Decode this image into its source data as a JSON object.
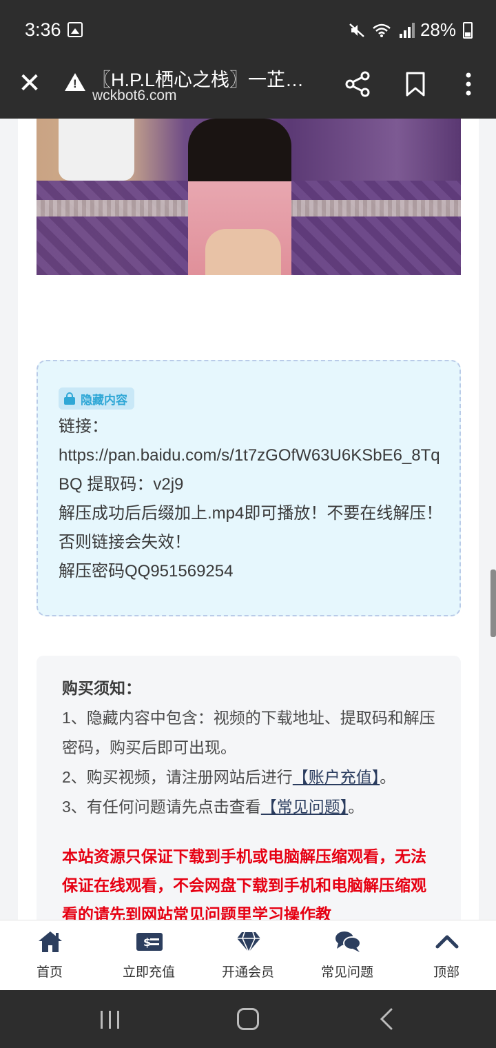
{
  "status_bar": {
    "time": "3:36",
    "battery": "28%"
  },
  "browser": {
    "title": "〖H.P.L栖心之栈〗一芷…",
    "url": "wckbot6.com"
  },
  "hidden_content": {
    "badge": "隐藏内容",
    "lines": [
      "链接：",
      "https://pan.baidu.com/s/1t7zGOfW63U6KSbE6_8TqBQ 提取码：v2j9",
      "解压成功后后缀加上.mp4即可播放！不要在线解压！否则链接会失效！",
      "解压密码QQ951569254"
    ]
  },
  "notice": {
    "heading": "购买须知：",
    "item1": "1、隐藏内容中包含：视频的下载地址、提取码和解压密码，购买后即可出现。",
    "item2_prefix": "2、购买视频，请注册网站后进行",
    "item2_link": "【账户充值】",
    "item2_suffix": "。",
    "item3_prefix": "3、有任何问题请先点击查看",
    "item3_link": "【常见问题】",
    "item3_suffix": "。",
    "warning": "本站资源只保证下载到手机或电脑解压缩观看，无法保证在线观看，不会网盘下载到手机和电脑解压缩观看的请先到网站常见问题里学习操作教"
  },
  "bottom_nav": {
    "items": [
      {
        "label": "首页",
        "icon": "home-icon"
      },
      {
        "label": "立即充值",
        "icon": "money-icon"
      },
      {
        "label": "开通会员",
        "icon": "diamond-icon"
      },
      {
        "label": "常见问题",
        "icon": "chat-icon"
      },
      {
        "label": "顶部",
        "icon": "chevron-up-icon"
      }
    ]
  },
  "colors": {
    "accent": "#2fa7d6",
    "warning": "#e60012",
    "nav_icon": "#2c3e5e"
  }
}
